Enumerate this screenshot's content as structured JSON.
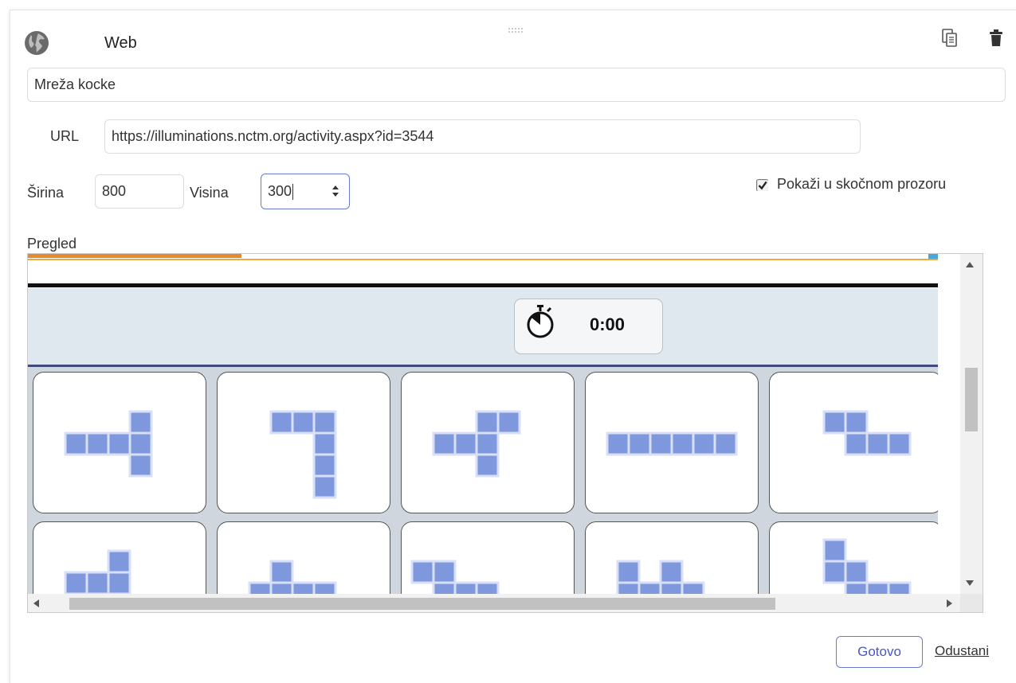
{
  "header": {
    "title": "Web",
    "icons": {
      "type": "globe-icon",
      "copy": "copy-icon",
      "delete": "trash-icon",
      "drag": "drag-handle-icon"
    }
  },
  "form": {
    "name_value": "Mreža kocke",
    "url_label": "URL",
    "url_value": "https://illuminations.nctm.org/activity.aspx?id=3544",
    "width_label": "Širina",
    "width_value": "800",
    "height_label": "Visina",
    "height_value": "300",
    "popup_label": "Pokaži u skočnom prozoru",
    "popup_checked": true
  },
  "preview": {
    "label": "Pregled",
    "timer": "0:00"
  },
  "actions": {
    "done_label": "Gotovo",
    "cancel_label": "Odustani"
  },
  "colors": {
    "accent": "#6b78d8",
    "square": "#7f97dd",
    "timer_bg": "#dfe8ef",
    "grid_bg": "#cfd6dd"
  }
}
